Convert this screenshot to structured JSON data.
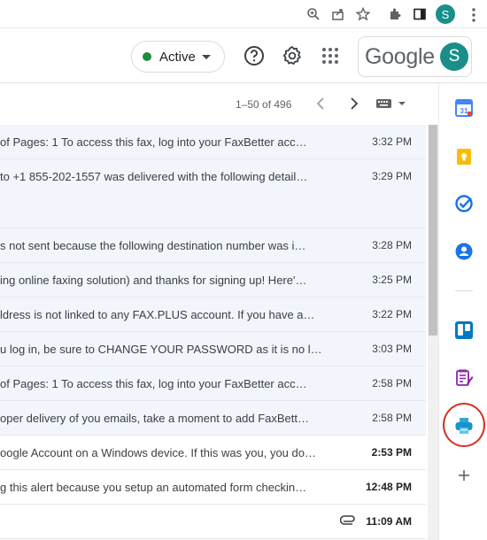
{
  "account": {
    "initial": "S",
    "brand": "Google"
  },
  "status": {
    "label": "Active"
  },
  "pager": {
    "range": "1–50 of 496"
  },
  "emails": [
    {
      "snippet": "of Pages: 1 To access this fax, log into your FaxBetter acc…",
      "time": "3:32 PM",
      "read": true,
      "attachment": false
    },
    {
      "snippet": "to +1 855-202-1557 was delivered with the following detail…",
      "time": "3:29 PM",
      "read": true,
      "attachment": false,
      "tall": true
    },
    {
      "snippet": "s not sent because the following destination number was i…",
      "time": "3:28 PM",
      "read": true,
      "attachment": false
    },
    {
      "snippet": "ing online faxing solution) and thanks for signing up! Here'…",
      "time": "3:25 PM",
      "read": true,
      "attachment": false
    },
    {
      "snippet": "ldress is not linked to any FAX.PLUS account. If you have a…",
      "time": "3:22 PM",
      "read": true,
      "attachment": false
    },
    {
      "snippet": "u log in, be sure to CHANGE YOUR PASSWORD as it is no l…",
      "time": "3:03 PM",
      "read": true,
      "attachment": false
    },
    {
      "snippet": "of Pages: 1 To access this fax, log into your FaxBetter acc…",
      "time": "2:58 PM",
      "read": true,
      "attachment": false
    },
    {
      "snippet": "oper delivery of you emails, take a moment to add FaxBett…",
      "time": "2:58 PM",
      "read": true,
      "attachment": false
    },
    {
      "snippet": "oogle Account on a Windows device. If this was you, you do…",
      "time": "2:53 PM",
      "read": false,
      "attachment": false
    },
    {
      "snippet": "g this alert because you setup an automated form checkin…",
      "time": "12:48 PM",
      "read": false,
      "attachment": false
    },
    {
      "snippet": "",
      "time": "11:09 AM",
      "read": false,
      "attachment": true
    }
  ],
  "side_panel": {
    "apps": [
      "calendar-icon",
      "keep-icon",
      "tasks-icon",
      "contacts-icon",
      "trello-icon",
      "form-notes-icon",
      "fax-printer-icon",
      "add-icon"
    ]
  },
  "colors": {
    "accent_green": "#1e8e3e",
    "avatar": "#1a8f8a",
    "highlight_ring": "#d93025"
  }
}
